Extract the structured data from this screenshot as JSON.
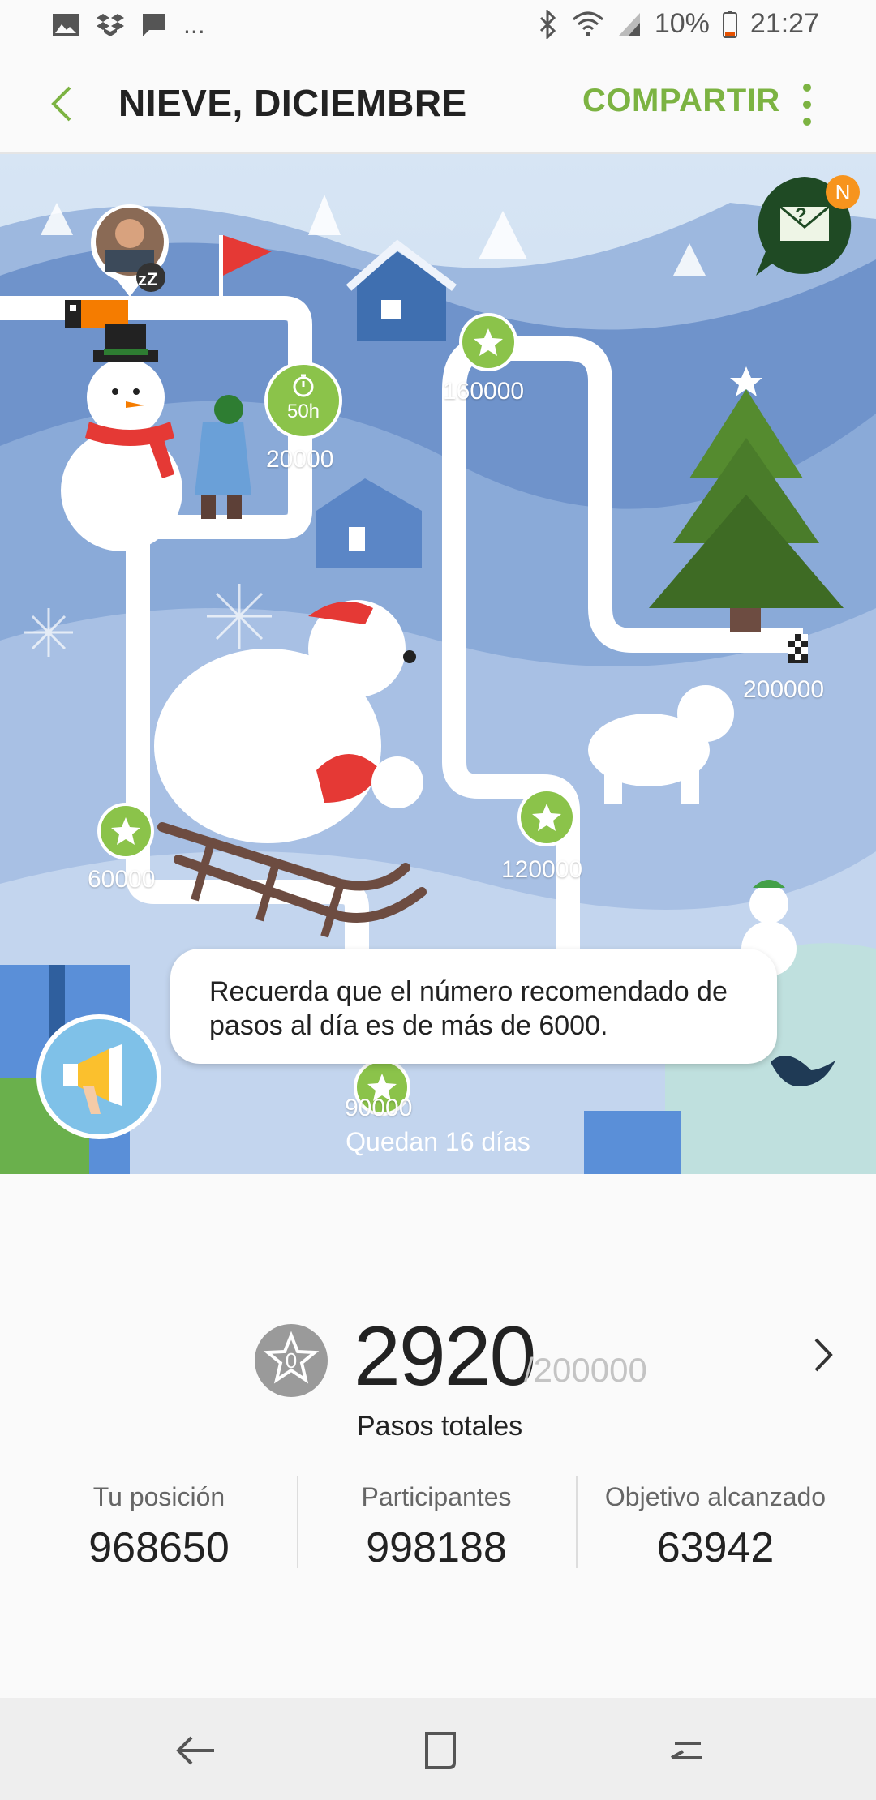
{
  "status_bar": {
    "battery": "10%",
    "time": "21:27",
    "notification_icons": [
      "image-icon",
      "dropbox-icon",
      "message-icon"
    ],
    "more_indicator": "..."
  },
  "app_bar": {
    "title": "NIEVE, DICIEMBRE",
    "share_label": "COMPARTIR"
  },
  "map": {
    "milestones": [
      {
        "value": "20000",
        "badge": "50h"
      },
      {
        "value": "60000"
      },
      {
        "value": "90000"
      },
      {
        "value": "120000"
      },
      {
        "value": "160000"
      },
      {
        "value": "200000"
      }
    ],
    "notification_badge": "N",
    "envelope_mark": "?",
    "sleep_mark": "zZ",
    "tip": "Recuerda que el número recomendado de pasos al día es de más de 6000.",
    "remaining": "Quedan 16 días"
  },
  "stats": {
    "stars": "0",
    "total_steps": "2920",
    "goal": "/200000",
    "total_label": "Pasos totales",
    "columns": [
      {
        "label": "Tu posición",
        "value": "968650"
      },
      {
        "label": "Participantes",
        "value": "998188"
      },
      {
        "label": "Objetivo alcanzado",
        "value": "63942"
      }
    ]
  },
  "colors": {
    "accent_green": "#7cb342",
    "sky": "#c9dbef",
    "path": "#ffffff"
  }
}
